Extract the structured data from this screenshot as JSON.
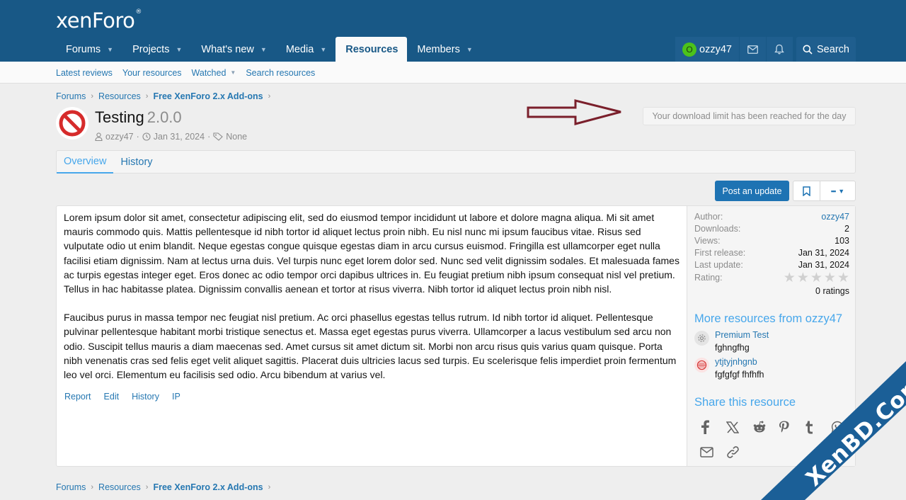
{
  "header": {
    "logo": "xenForo",
    "logo_mark": "®",
    "nav": [
      {
        "label": "Forums",
        "has_menu": true
      },
      {
        "label": "Projects",
        "has_menu": true
      },
      {
        "label": "What's new",
        "has_menu": true
      },
      {
        "label": "Media",
        "has_menu": true
      },
      {
        "label": "Resources",
        "has_menu": false,
        "active": true
      },
      {
        "label": "Members",
        "has_menu": true
      }
    ],
    "user": {
      "avatar_letter": "O",
      "name": "ozzy47",
      "avatar_color": "#4cc21b"
    },
    "search_label": "Search"
  },
  "subnav": [
    "Latest reviews",
    "Your resources",
    "Watched",
    "Search resources"
  ],
  "breadcrumb": [
    "Forums",
    "Resources",
    "Free XenForo 2.x Add-ons"
  ],
  "resource": {
    "title": "Testing",
    "version": "2.0.0",
    "author": "ozzy47",
    "date": "Jan 31, 2024",
    "tags": "None"
  },
  "download_limit_notice": "Your download limit has been reached for the day",
  "tabs": [
    "Overview",
    "History"
  ],
  "actions": {
    "post_update": "Post an update",
    "more": "•••"
  },
  "content": {
    "paragraphs": [
      "Lorem ipsum dolor sit amet, consectetur adipiscing elit, sed do eiusmod tempor incididunt ut labore et dolore magna aliqua. Mi sit amet mauris commodo quis. Mattis pellentesque id nibh tortor id aliquet lectus proin nibh. Eu nisl nunc mi ipsum faucibus vitae. Risus sed vulputate odio ut enim blandit. Neque egestas congue quisque egestas diam in arcu cursus euismod. Fringilla est ullamcorper eget nulla facilisi etiam dignissim. Nam at lectus urna duis. Vel turpis nunc eget lorem dolor sed. Nunc sed velit dignissim sodales. Et malesuada fames ac turpis egestas integer eget. Eros donec ac odio tempor orci dapibus ultrices in. Eu feugiat pretium nibh ipsum consequat nisl vel pretium. Tellus in hac habitasse platea. Dignissim convallis aenean et tortor at risus viverra. Nibh tortor id aliquet lectus proin nibh nisl.",
      "Faucibus purus in massa tempor nec feugiat nisl pretium. Ac orci phasellus egestas tellus rutrum. Id nibh tortor id aliquet. Pellentesque pulvinar pellentesque habitant morbi tristique senectus et. Massa eget egestas purus viverra. Ullamcorper a lacus vestibulum sed arcu non odio. Suscipit tellus mauris a diam maecenas sed. Amet cursus sit amet dictum sit. Morbi non arcu risus quis varius quam quisque. Porta nibh venenatis cras sed felis eget velit aliquet sagittis. Placerat duis ultricies lacus sed turpis. Eu scelerisque felis imperdiet proin fermentum leo vel orci. Elementum eu facilisis sed odio. Arcu bibendum at varius vel."
    ],
    "actions": [
      "Report",
      "Edit",
      "History",
      "IP"
    ]
  },
  "sidebar": {
    "stats": [
      {
        "key": "Author:",
        "value": "ozzy47",
        "link": true
      },
      {
        "key": "Downloads:",
        "value": "2"
      },
      {
        "key": "Views:",
        "value": "103"
      },
      {
        "key": "First release:",
        "value": "Jan 31, 2024"
      },
      {
        "key": "Last update:",
        "value": "Jan 31, 2024"
      }
    ],
    "rating_label": "Rating:",
    "rating_value": 0,
    "rating_max": 5,
    "ratings_count": "0 ratings",
    "more_heading": "More resources from ozzy47",
    "more_items": [
      {
        "title": "Premium Test",
        "desc": "fghngfhg",
        "icon": "gear-icon"
      },
      {
        "title": "ytjtyjnhgnb",
        "desc": "fgfgfgf fhfhfh",
        "icon": "badge-icon"
      }
    ],
    "share_heading": "Share this resource",
    "share_icons": [
      "facebook-icon",
      "x-icon",
      "reddit-icon",
      "pinterest-icon",
      "tumblr-icon",
      "whatsapp-icon",
      "email-icon",
      "link-icon"
    ]
  },
  "watermark": "XenBD.Com"
}
